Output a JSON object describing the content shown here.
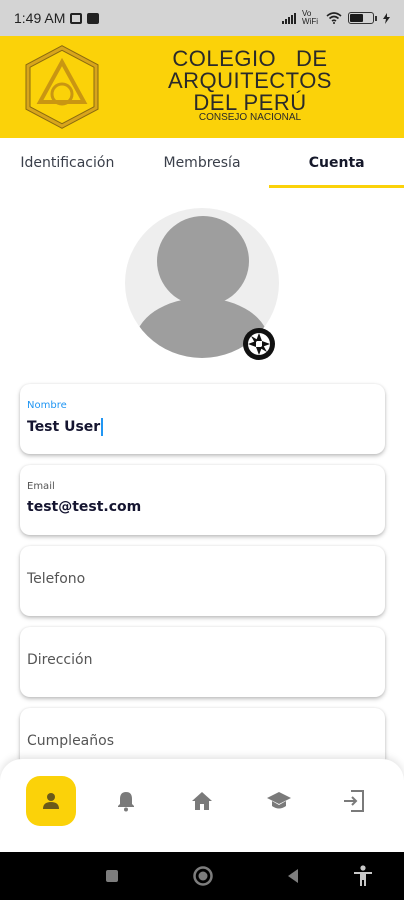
{
  "status_bar": {
    "time": "1:49 AM",
    "network_label": "Vo WiFi"
  },
  "header": {
    "org_name_line1": "COLEGIO   DE",
    "org_name_line2": "ARQUITECTOS",
    "org_name_line3": "DEL PERÚ",
    "org_subtitle": "CONSEJO NACIONAL",
    "brand_color": "#fbd209"
  },
  "tabs": [
    {
      "label": "Identificación",
      "active": false
    },
    {
      "label": "Membresía",
      "active": false
    },
    {
      "label": "Cuenta",
      "active": true
    }
  ],
  "form": {
    "nombre": {
      "label": "Nombre",
      "value": "Test User"
    },
    "email": {
      "label": "Email",
      "value": "test@test.com"
    },
    "telefono": {
      "label": "Telefono"
    },
    "direccion": {
      "label": "Dirección"
    },
    "cumpleanos": {
      "label": "Cumpleaños"
    }
  },
  "bottom_nav": [
    {
      "icon": "person-icon",
      "active": true
    },
    {
      "icon": "bell-icon",
      "active": false
    },
    {
      "icon": "home-icon",
      "active": false
    },
    {
      "icon": "graduation-cap-icon",
      "active": false
    },
    {
      "icon": "logout-icon",
      "active": false
    }
  ]
}
